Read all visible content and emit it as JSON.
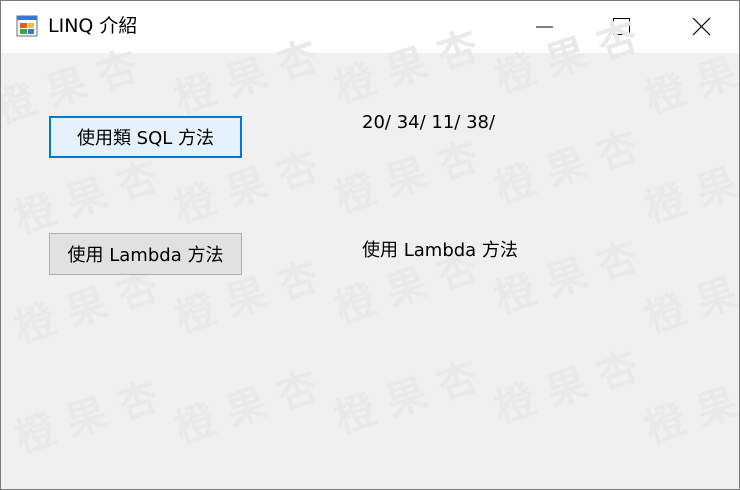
{
  "window": {
    "title": "LINQ 介紹"
  },
  "watermark": {
    "text": "橙果杏"
  },
  "buttons": {
    "sql_label": "使用類 SQL 方法",
    "lambda_label": "使用 Lambda 方法"
  },
  "labels": {
    "sql_result": "20/ 34/ 11/ 38/",
    "lambda_result": "使用 Lambda 方法"
  },
  "colors": {
    "focus_border": "#0078d7",
    "client_background": "#f0f0f0",
    "button_face": "#e1e1e1"
  }
}
